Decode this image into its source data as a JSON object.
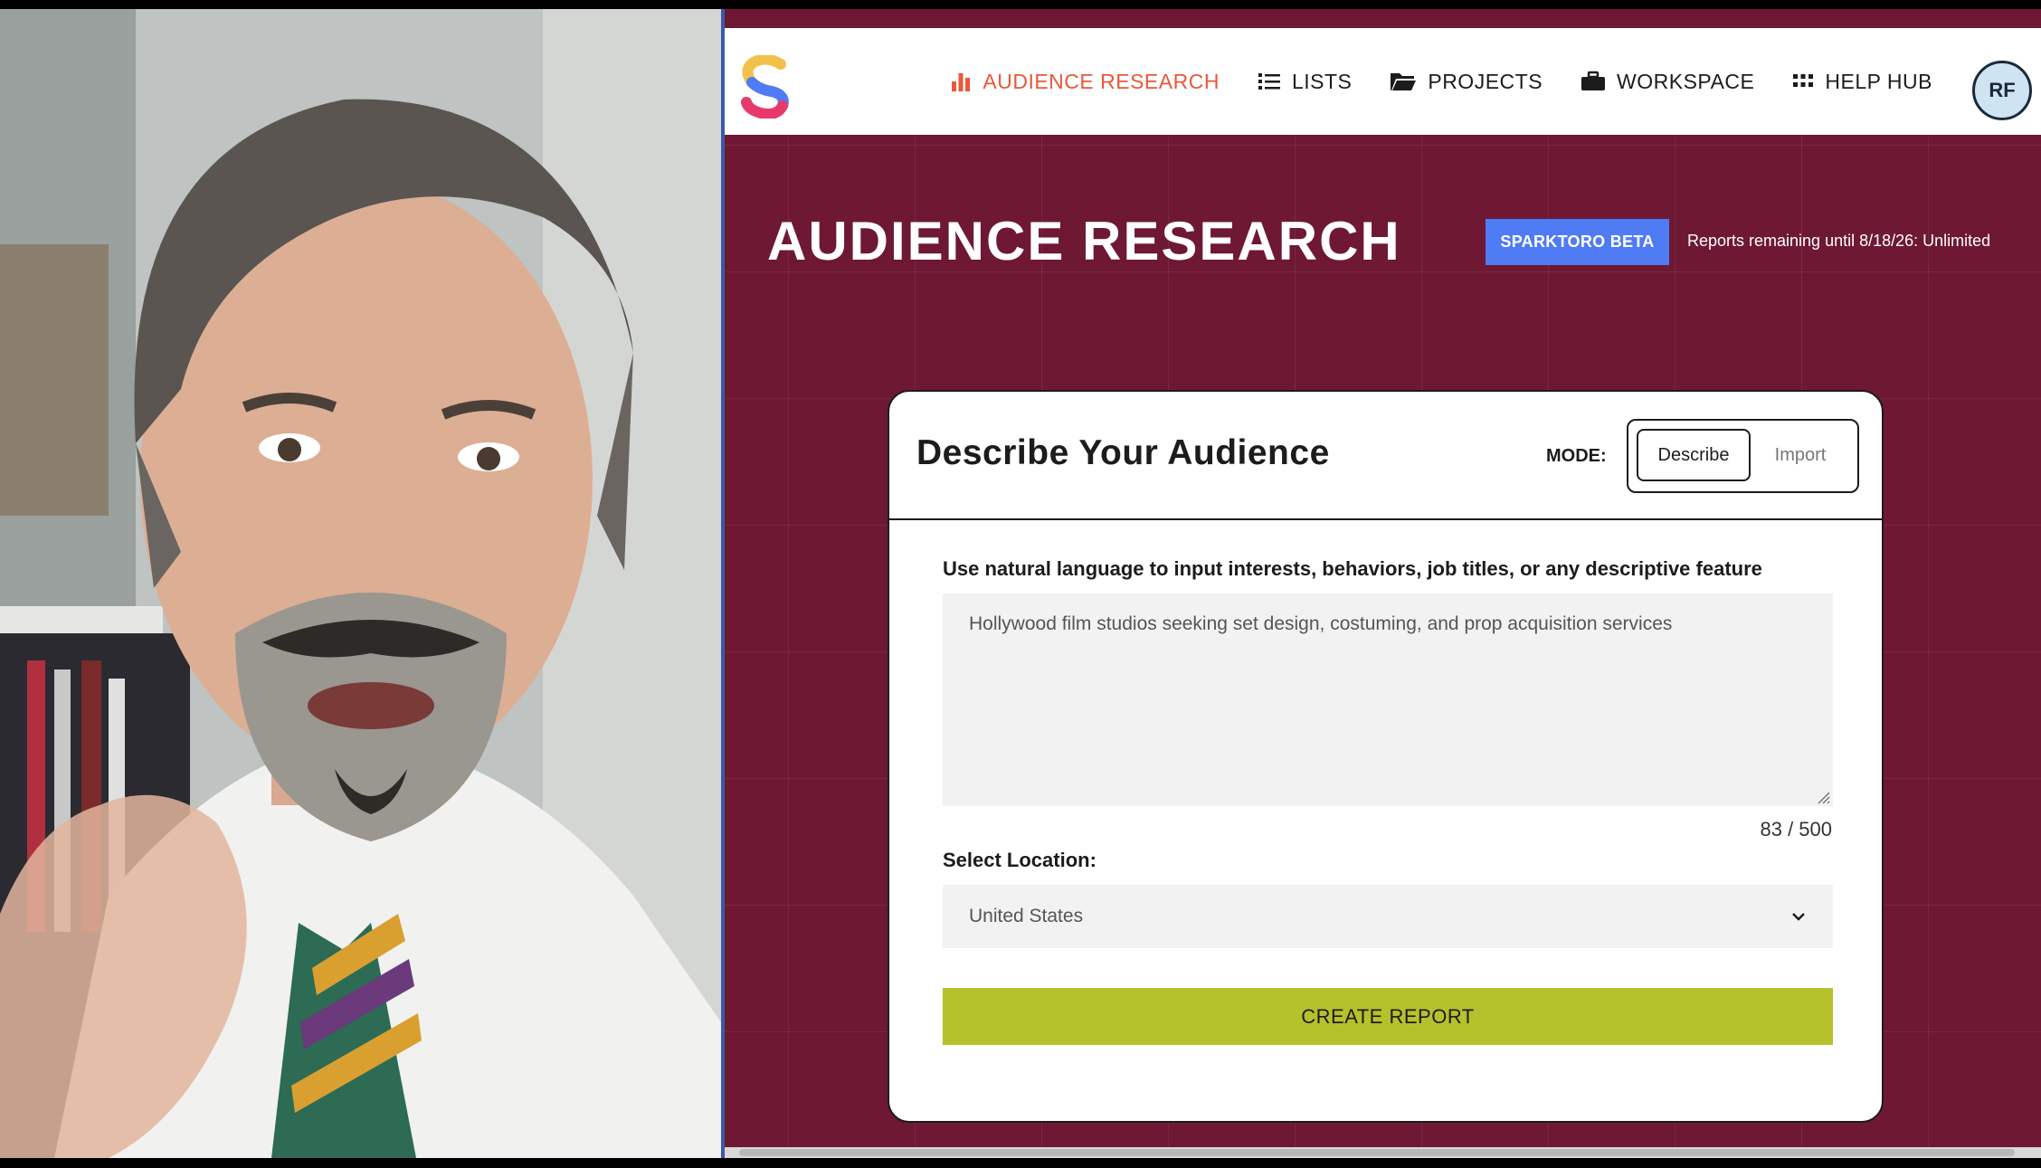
{
  "nav": {
    "items": [
      {
        "label": "AUDIENCE RESEARCH",
        "icon": "bar-chart-icon",
        "active": true
      },
      {
        "label": "LISTS",
        "icon": "list-icon",
        "active": false
      },
      {
        "label": "PROJECTS",
        "icon": "folder-icon",
        "active": false
      },
      {
        "label": "WORKSPACE",
        "icon": "briefcase-icon",
        "active": false
      },
      {
        "label": "HELP HUB",
        "icon": "grid-icon",
        "active": false
      }
    ],
    "avatar_initials": "RF"
  },
  "page": {
    "title": "AUDIENCE RESEARCH",
    "beta_badge": "SPARKTORO BETA",
    "reports_remaining": "Reports remaining until 8/18/26: Unlimited"
  },
  "card": {
    "title": "Describe Your Audience",
    "mode_label": "MODE:",
    "mode_options": [
      "Describe",
      "Import"
    ],
    "mode_selected": "Describe",
    "instruction": "Use natural language to input interests, behaviors, job titles, or any descriptive feature",
    "description_value": "Hollywood film studios seeking set design, costuming, and prop acquisition services",
    "char_count": "83 / 500",
    "location_label": "Select Location:",
    "location_value": "United States",
    "create_button": "CREATE REPORT"
  },
  "colors": {
    "brand_maroon": "#6e1834",
    "active_nav": "#e8593a",
    "beta_badge": "#4f7bf4",
    "create_button": "#b5c22b"
  }
}
